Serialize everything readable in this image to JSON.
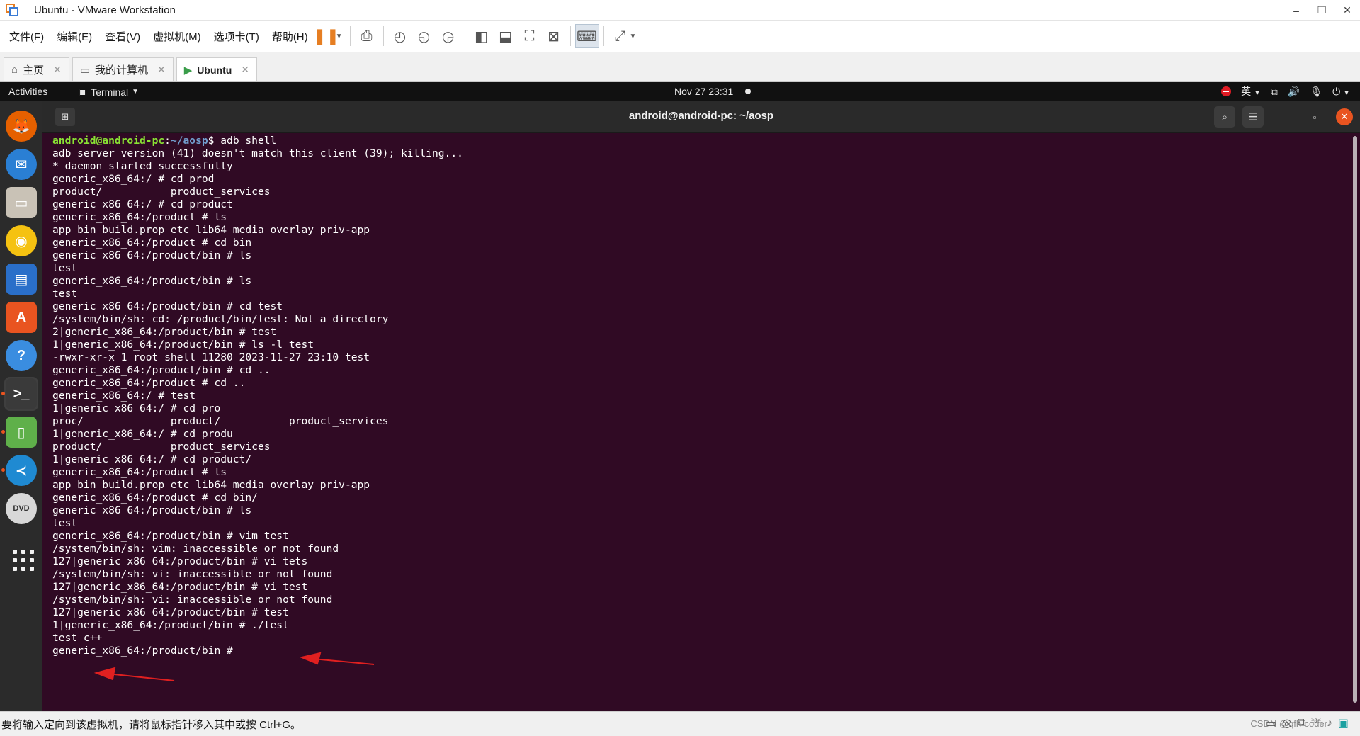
{
  "window": {
    "title": "Ubuntu - VMware Workstation",
    "controls": [
      "–",
      "❐",
      "✕"
    ]
  },
  "menu": [
    "文件(F)",
    "编辑(E)",
    "查看(V)",
    "虚拟机(M)",
    "选项卡(T)",
    "帮助(H)"
  ],
  "toolbar_icons": [
    "pause-icon",
    "send-ctrl-alt-del-icon",
    "snapshot-icon",
    "revert-snapshot-icon",
    "snapshot-manager-icon",
    "library-icon",
    "thumbnail-bar-icon",
    "full-screen-icon",
    "unity-icon",
    "console-view-icon",
    "stretch-icon"
  ],
  "tabs": [
    {
      "label": "主页",
      "icon": "home-icon",
      "active": false
    },
    {
      "label": "我的计算机",
      "icon": "computer-icon",
      "active": false
    },
    {
      "label": "Ubuntu",
      "icon": "vm-icon",
      "active": true
    }
  ],
  "ubuntu_topbar": {
    "activities": "Activities",
    "app_menu": "Terminal",
    "clock": "Nov 27  23:31",
    "ime": "英"
  },
  "dock": [
    {
      "name": "firefox",
      "color": "#e66000",
      "glyph": "🦊",
      "running": false
    },
    {
      "name": "thunderbird",
      "color": "#2a7fd4",
      "glyph": "✉",
      "running": false
    },
    {
      "name": "files",
      "color": "#c9c2b6",
      "glyph": "▭",
      "running": false
    },
    {
      "name": "rhythmbox",
      "color": "#f5c211",
      "glyph": "◉",
      "running": false
    },
    {
      "name": "libreoffice-writer",
      "color": "#2a6fc9",
      "glyph": "▤",
      "running": false
    },
    {
      "name": "ubuntu-software",
      "color": "#e95420",
      "glyph": "A",
      "running": false
    },
    {
      "name": "help",
      "color": "#3a8de0",
      "glyph": "?",
      "running": false
    },
    {
      "name": "terminal",
      "color": "#3a3a3a",
      "glyph": ">_",
      "running": true
    },
    {
      "name": "android-emulator",
      "color": "#5fb04a",
      "glyph": "▯",
      "running": true
    },
    {
      "name": "vscode",
      "color": "#1f8ad2",
      "glyph": "≺",
      "running": true
    },
    {
      "name": "dvd",
      "color": "#d8d8d8",
      "glyph": "DVD",
      "running": false
    }
  ],
  "terminal": {
    "title": "android@android-pc: ~/aosp",
    "prompt_user": "android@android-pc",
    "prompt_path": "~/aosp",
    "first_command": "$ adb shell",
    "lines": [
      "adb server version (41) doesn't match this client (39); killing...",
      "* daemon started successfully",
      "generic_x86_64:/ # cd prod",
      "product/           product_services",
      "generic_x86_64:/ # cd product",
      "generic_x86_64:/product # ls",
      "app bin build.prop etc lib64 media overlay priv-app",
      "generic_x86_64:/product # cd bin",
      "generic_x86_64:/product/bin # ls",
      "test",
      "generic_x86_64:/product/bin # ls",
      "test",
      "generic_x86_64:/product/bin # cd test",
      "/system/bin/sh: cd: /product/bin/test: Not a directory",
      "2|generic_x86_64:/product/bin # test",
      "1|generic_x86_64:/product/bin # ls -l test",
      "-rwxr-xr-x 1 root shell 11280 2023-11-27 23:10 test",
      "generic_x86_64:/product/bin # cd ..",
      "generic_x86_64:/product # cd ..",
      "generic_x86_64:/ # test",
      "1|generic_x86_64:/ # cd pro",
      "proc/              product/           product_services",
      "1|generic_x86_64:/ # cd produ",
      "product/           product_services",
      "1|generic_x86_64:/ # cd product/",
      "generic_x86_64:/product # ls",
      "app bin build.prop etc lib64 media overlay priv-app",
      "generic_x86_64:/product # cd bin/",
      "generic_x86_64:/product/bin # ls",
      "test",
      "generic_x86_64:/product/bin # vim test",
      "/system/bin/sh: vim: inaccessible or not found",
      "127|generic_x86_64:/product/bin # vi tets",
      "/system/bin/sh: vi: inaccessible or not found",
      "127|generic_x86_64:/product/bin # vi test",
      "/system/bin/sh: vi: inaccessible or not found",
      "127|generic_x86_64:/product/bin # test",
      "1|generic_x86_64:/product/bin # ./test",
      "test c++",
      "generic_x86_64:/product/bin #"
    ]
  },
  "status_bar": {
    "message": "要将输入定向到该虚拟机，请将鼠标指针移入其中或按 Ctrl+G。",
    "watermark": "CSDN @qfh-coder"
  },
  "colors": {
    "terminal_bg": "#300a24",
    "prompt_user": "#8ae234",
    "prompt_path": "#729fcf",
    "accent": "#e95420",
    "annotation_arrow": "#e02020"
  }
}
